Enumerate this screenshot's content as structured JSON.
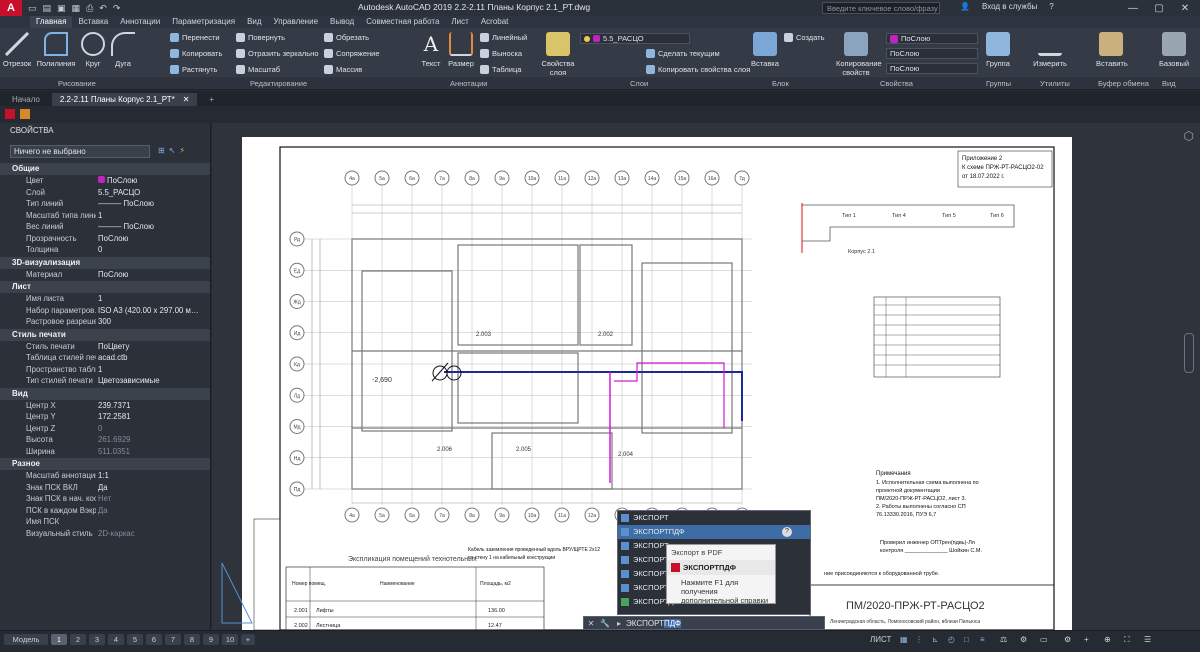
{
  "title_bar": {
    "logo": "A",
    "window_title": "Autodesk AutoCAD 2019   2.2-2.11 Планы Корпус 2.1_РТ.dwg",
    "search_placeholder": "Введите ключевое слово/фразу",
    "sign_in": "Вход в службы",
    "help": "?"
  },
  "menu": [
    "Главная",
    "Вставка",
    "Аннотации",
    "Параметризация",
    "Вид",
    "Управление",
    "Вывод",
    "Совместная работа",
    "Лист",
    "Acrobat"
  ],
  "ribbon": {
    "draw_tools": [
      "Отрезок",
      "Полилиния",
      "Круг",
      "Дуга"
    ],
    "modify_tools": [
      "Перенести",
      "Повернуть",
      "Обрезать",
      "Копировать",
      "Отразить зеркально",
      "Сопряжение",
      "Растянуть",
      "Масштаб",
      "Массив"
    ],
    "annotation_tools": [
      "Текст",
      "Размер",
      "Линейный",
      "Выноска",
      "Таблица"
    ],
    "layer_panel": {
      "props_button": "Свойства слоя",
      "layer_name": "5.5_РАСЦО",
      "make_current": "Сделать текущим",
      "copy_props": "Копировать свойства слоя"
    },
    "block_panel": [
      "Вставка",
      "Создать"
    ],
    "properties_panel": {
      "button": "Копирование свойств",
      "color": "ПоСлою",
      "lineweight": "ПоСлою",
      "linetype": "ПоСлою"
    },
    "groups": "Группа",
    "measure": "Измерить",
    "paste": "Вставить",
    "base": "Базовый",
    "panel_labels": [
      "Рисование",
      "Редактирование",
      "Аннотации",
      "Слои",
      "Блок",
      "Свойства",
      "Группы",
      "Утилиты",
      "Буфер обмена",
      "Вид"
    ]
  },
  "file_tabs": [
    "Начало",
    "2.2-2.11 Планы Корпус 2.1_РТ*"
  ],
  "properties": {
    "title": "СВОЙСТВА",
    "selection": "Ничего не выбрано",
    "sections": [
      {
        "name": "Общие",
        "rows": [
          [
            "Цвет",
            "ПоСлою"
          ],
          [
            "Слой",
            "5.5_РАСЦО"
          ],
          [
            "Тип линий",
            "——— ПоСлою"
          ],
          [
            "Масштаб типа линий",
            "1"
          ],
          [
            "Вес линий",
            "——— ПоСлою"
          ],
          [
            "Прозрачность",
            "ПоСлою"
          ],
          [
            "Толщина",
            "0"
          ]
        ]
      },
      {
        "name": "3D-визуализация",
        "rows": [
          [
            "Материал",
            "ПоСлою"
          ]
        ]
      },
      {
        "name": "Лист",
        "rows": [
          [
            "Имя листа",
            "1"
          ],
          [
            "Набор параметров…",
            "ISO A3 (420.00 x 297.00 м…"
          ],
          [
            "Растровое разреше…",
            "300"
          ]
        ]
      },
      {
        "name": "Стиль печати",
        "rows": [
          [
            "Стиль печати",
            "ПоЦвету"
          ],
          [
            "Таблица стилей печ…",
            "acad.ctb"
          ],
          [
            "Пространство табли…",
            "1"
          ],
          [
            "Тип стилей печати",
            "Цветозависимые"
          ]
        ]
      },
      {
        "name": "Вид",
        "rows": [
          [
            "Центр X",
            "239.7371"
          ],
          [
            "Центр Y",
            "172.2581"
          ],
          [
            "Центр Z",
            "0"
          ],
          [
            "Высота",
            "261.6929"
          ],
          [
            "Ширина",
            "511.0351"
          ]
        ]
      },
      {
        "name": "Разное",
        "rows": [
          [
            "Масштаб аннотаций",
            "1:1"
          ],
          [
            "Знак ПСК ВКЛ",
            "Да"
          ],
          [
            "Знак ПСК в нач. коо…",
            "Нет"
          ],
          [
            "ПСК в каждом Вэкр…",
            "Да"
          ],
          [
            "Имя ПСК",
            ""
          ],
          [
            "Визуальный стиль",
            "2D-каркас"
          ]
        ]
      }
    ]
  },
  "drawing": {
    "title_block": [
      "Приложение 2",
      "К схеме ПРЖ-РТ-РАСЦО2-02",
      "от 18.07.2022 г."
    ],
    "axes_top": [
      "4а",
      "5а",
      "6а",
      "7а",
      "8а",
      "9а",
      "10а",
      "11а",
      "12а",
      "13а",
      "14а",
      "15а",
      "16а",
      "7д"
    ],
    "axes_left": [
      "Рд",
      "Ед",
      "Жд",
      "Ид",
      "Кд",
      "Лд",
      "Мд",
      "Нд",
      "Пд"
    ],
    "room_marks": [
      "-2,690",
      "2.003",
      "2.002",
      "2.004",
      "2.005",
      "2.006"
    ],
    "tiles": [
      "Тип 1",
      "Тип 4",
      "Тип 5",
      "Тип 6"
    ],
    "korpus": "Корпус 2.1",
    "notes_title": "Примечания",
    "notes": [
      "1. Исполнительная схема выполнена по",
      "проектной документации",
      "ПМ/2020-ПРЖ-РТ-РАСЦО2, лист 3.",
      "2. Работы выполнены согласно СП",
      "76.13330.2016, ПУЭ 6,7"
    ],
    "signature": [
      "Проверил инженер ОПТрен(пдвь)-Ля",
      "контроля ______________ Шойкин С.М."
    ],
    "stamp_code": "ПМ/2020-ПРЖ-РТ-РАСЦО2",
    "explication_title": "Экспликация помещений технотельных",
    "table_headers": [
      "Номер помещ.",
      "Наименование",
      "Площадь, м2"
    ],
    "table_rows": [
      [
        "2.001",
        "Лифты",
        "136.00"
      ],
      [
        "2.002",
        "Лестница",
        "12.47"
      ]
    ],
    "cable_note": "Кабель заземления проведенный вдоль ВРУ/ЩРТЕ 2x12",
    "cable_note2": "по стену 1 на кабельный конструкции",
    "bottom_note": "ние присоединяются к оборудованной трубе.",
    "address": "Ленинградская область, Ломоносовский район, вблизи Пильюса"
  },
  "autocomplete": {
    "items": [
      "ЭКСПОРТ",
      "ЭКСПОРТПДФ",
      "ЭКСПОРТ",
      "ЭКСПОРТ",
      "ЭКСПОРТ",
      "ЭКСПОРТ",
      "ЭКСПОРТДВФ"
    ],
    "tooltip_title": "Экспорт в PDF",
    "tooltip_cmd": "ЭКСПОРТПДФ",
    "tooltip_help": "Нажмите F1 для получения дополнительной справки"
  },
  "command_line": {
    "prefix": "ЭКСПОРТ",
    "typed": "ПДФ"
  },
  "layout_tabs": [
    "Модель",
    "1",
    "2",
    "3",
    "4",
    "5",
    "6",
    "7",
    "8",
    "9",
    "10"
  ],
  "status_bar": {
    "mode": "ЛИСТ"
  }
}
